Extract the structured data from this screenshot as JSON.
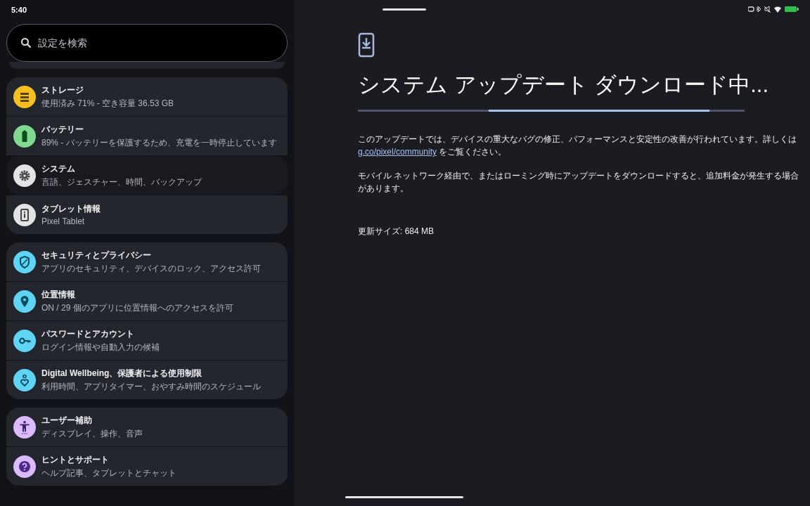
{
  "status_bar": {
    "time": "5:40"
  },
  "search": {
    "placeholder": "設定を検索"
  },
  "groups": [
    {
      "items": [
        {
          "title": "ストレージ",
          "subtitle": "使用済み 71% - 空き容量 36.53 GB",
          "color": "#f6be1e",
          "kind": "storage",
          "selected": false
        },
        {
          "title": "バッテリー",
          "subtitle": "89% - バッテリーを保護するため、充電を一時停止しています",
          "color": "#80d98e",
          "kind": "battery",
          "selected": false
        },
        {
          "title": "システム",
          "subtitle": "言語、ジェスチャー、時間、バックアップ",
          "color": "#e3e3e3",
          "kind": "system",
          "selected": true
        },
        {
          "title": "タブレット情報",
          "subtitle": "Pixel Tablet",
          "color": "#e3e3e3",
          "kind": "about",
          "selected": false
        }
      ]
    },
    {
      "items": [
        {
          "title": "セキュリティとプライバシー",
          "subtitle": "アプリのセキュリティ、デバイスのロック、アクセス許可",
          "color": "#5fd4f4",
          "kind": "security",
          "selected": false
        },
        {
          "title": "位置情報",
          "subtitle": "ON / 29 個のアプリに位置情報へのアクセスを許可",
          "color": "#5fd4f4",
          "kind": "location",
          "selected": false
        },
        {
          "title": "パスワードとアカウント",
          "subtitle": "ログイン情報や自動入力の候補",
          "color": "#5fd4f4",
          "kind": "passwords",
          "selected": false
        },
        {
          "title": "Digital Wellbeing、保護者による使用制限",
          "subtitle": "利用時間、アプリタイマー、おやすみ時間のスケジュール",
          "color": "#5fd4f4",
          "kind": "wellbeing",
          "selected": false
        }
      ]
    },
    {
      "items": [
        {
          "title": "ユーザー補助",
          "subtitle": "ディスプレイ、操作、音声",
          "color": "#dcbaff",
          "kind": "accessibility",
          "selected": false
        },
        {
          "title": "ヒントとサポート",
          "subtitle": "ヘルプ記事、タブレットとチャット",
          "color": "#dcbaff",
          "kind": "help",
          "selected": false
        }
      ]
    }
  ],
  "detail": {
    "title": "システム アップデート ダウンロード中...",
    "paragraphs": [
      {
        "before": "このアップデートでは、デバイスの重大なバグの修正、パフォーマンスと安定性の改善が行われています。詳しくは",
        "link": "g.co/pixel/community",
        "after": " をご覧ください。"
      },
      {
        "before": "モバイル ネットワーク経由で、またはローミング時にアップデートをダウンロードすると、追加料金が発生する場合があります。"
      }
    ],
    "size": "更新サイズ: 684 MB"
  }
}
